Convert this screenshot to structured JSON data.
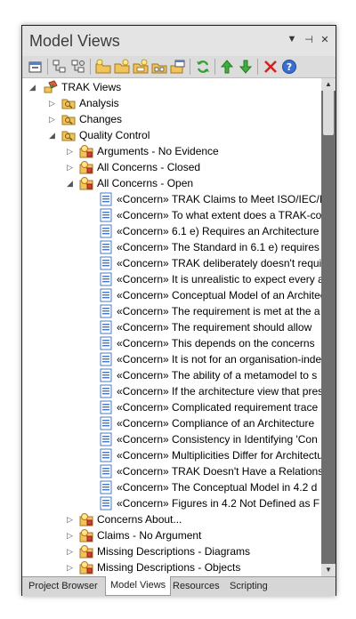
{
  "window": {
    "title": "Model Views",
    "controls": [
      "▼",
      "⊣",
      "✕"
    ]
  },
  "toolbar": {
    "icons": [
      "view-properties-icon",
      "model-tree-icon",
      "model-tree-2-icon",
      "new-folder-icon",
      "new-view-icon",
      "new-view-2-icon",
      "new-slideshow-icon",
      "open-view-icon",
      "refresh-icon",
      "move-up-icon",
      "move-down-icon",
      "delete-icon",
      "help-icon"
    ]
  },
  "tree": [
    {
      "label": "TRAK Views",
      "level": 0,
      "expander": "expanded",
      "icon": "root-icon"
    },
    {
      "label": "Analysis",
      "level": 1,
      "expander": "collapsed",
      "icon": "search-folder-icon"
    },
    {
      "label": "Changes",
      "level": 1,
      "expander": "collapsed",
      "icon": "search-folder-icon"
    },
    {
      "label": "Quality Control",
      "level": 1,
      "expander": "expanded",
      "icon": "search-folder-icon"
    },
    {
      "label": "Arguments - No Evidence",
      "level": 2,
      "expander": "collapsed",
      "icon": "search-view-icon"
    },
    {
      "label": "All Concerns - Closed",
      "level": 2,
      "expander": "collapsed",
      "icon": "search-view-icon"
    },
    {
      "label": "All Concerns - Open",
      "level": 2,
      "expander": "expanded",
      "icon": "search-view-icon"
    },
    {
      "label": "«Concern» TRAK Claims to Meet ISO/IEC/IEEE",
      "level": 3,
      "expander": "none",
      "icon": "concern-icon"
    },
    {
      "label": "«Concern» To what extent does a TRAK-conformant",
      "level": 3,
      "expander": "none",
      "icon": "concern-icon"
    },
    {
      "label": "«Concern» 6.1 e) Requires an Architecture",
      "level": 3,
      "expander": "none",
      "icon": "concern-icon"
    },
    {
      "label": "«Concern» The Standard in 6.1 e) requires",
      "level": 3,
      "expander": "none",
      "icon": "concern-icon"
    },
    {
      "label": "«Concern» TRAK deliberately doesn't require",
      "level": 3,
      "expander": "none",
      "icon": "concern-icon"
    },
    {
      "label": "«Concern» It is unrealistic to expect every a",
      "level": 3,
      "expander": "none",
      "icon": "concern-icon"
    },
    {
      "label": "«Concern» Conceptual Model of an Architecture",
      "level": 3,
      "expander": "none",
      "icon": "concern-icon"
    },
    {
      "label": "«Concern» The requirement is met at the a",
      "level": 3,
      "expander": "none",
      "icon": "concern-icon"
    },
    {
      "label": "«Concern» The requirement should allow",
      "level": 3,
      "expander": "none",
      "icon": "concern-icon"
    },
    {
      "label": "«Concern» This depends on the concerns",
      "level": 3,
      "expander": "none",
      "icon": "concern-icon"
    },
    {
      "label": "«Concern» It is not for an organisation-independent",
      "level": 3,
      "expander": "none",
      "icon": "concern-icon"
    },
    {
      "label": "«Concern» The ability of a metamodel to s",
      "level": 3,
      "expander": "none",
      "icon": "concern-icon"
    },
    {
      "label": "«Concern» If the architecture view that presents",
      "level": 3,
      "expander": "none",
      "icon": "concern-icon"
    },
    {
      "label": "«Concern» Complicated requirement trace",
      "level": 3,
      "expander": "none",
      "icon": "concern-icon"
    },
    {
      "label": "«Concern» Compliance of an Architecture",
      "level": 3,
      "expander": "none",
      "icon": "concern-icon"
    },
    {
      "label": "«Concern» Consistency in Identifying 'Con",
      "level": 3,
      "expander": "none",
      "icon": "concern-icon"
    },
    {
      "label": "«Concern» Multiplicities Differ for Architecture",
      "level": 3,
      "expander": "none",
      "icon": "concern-icon"
    },
    {
      "label": "«Concern» TRAK Doesn't Have a Relationship",
      "level": 3,
      "expander": "none",
      "icon": "concern-icon"
    },
    {
      "label": "«Concern» The Conceptual Model in 4.2 d",
      "level": 3,
      "expander": "none",
      "icon": "concern-icon"
    },
    {
      "label": "«Concern» Figures in 4.2 Not Defined as F",
      "level": 3,
      "expander": "none",
      "icon": "concern-icon"
    },
    {
      "label": "Concerns About...",
      "level": 2,
      "expander": "collapsed",
      "icon": "search-view-icon"
    },
    {
      "label": "Claims - No Argument",
      "level": 2,
      "expander": "collapsed",
      "icon": "search-view-icon"
    },
    {
      "label": "Missing Descriptions - Diagrams",
      "level": 2,
      "expander": "collapsed",
      "icon": "search-view-icon"
    },
    {
      "label": "Missing Descriptions - Objects",
      "level": 2,
      "expander": "collapsed",
      "icon": "search-view-icon"
    }
  ],
  "tabs": [
    {
      "label": "Project Browser",
      "active": false
    },
    {
      "label": "Model Views",
      "active": true
    },
    {
      "label": "Resources",
      "active": false
    },
    {
      "label": "Scripting",
      "active": false
    }
  ],
  "colors": {
    "folder": "#f2c35a",
    "concern": "#4a78c0",
    "refresh": "#2f9e2f",
    "delete": "#d42020",
    "help": "#3a6fd0"
  }
}
